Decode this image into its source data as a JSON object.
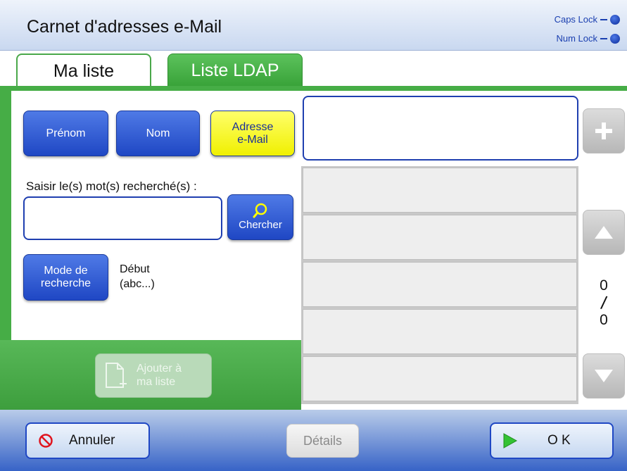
{
  "header": {
    "title": "Carnet d'adresses e-Mail",
    "caps_lock": "Caps Lock",
    "num_lock": "Num Lock"
  },
  "tabs": [
    {
      "label": "Ma liste",
      "active": false
    },
    {
      "label": "Liste LDAP",
      "active": true
    }
  ],
  "filters": {
    "first_name": "Prénom",
    "last_name": "Nom",
    "email_line1": "Adresse",
    "email_line2": "e-Mail",
    "selected": "email"
  },
  "search": {
    "label": "Saisir le(s) mot(s) recherché(s) :",
    "value": "",
    "button": "Chercher"
  },
  "mode": {
    "button_line1": "Mode de",
    "button_line2": "recherche",
    "value_line1": "Début",
    "value_line2": "(abc...)"
  },
  "add_to_list": {
    "line1": "Ajouter à",
    "line2": "ma liste",
    "enabled": false
  },
  "results": {
    "email_field": "",
    "rows": [
      "",
      "",
      "",
      "",
      ""
    ],
    "page_current": "0",
    "page_total": "0"
  },
  "footer": {
    "cancel": "Annuler",
    "details": "Détails",
    "ok": "O K"
  },
  "colors": {
    "accent_green": "#46ad46",
    "accent_blue": "#1f47c4",
    "selected_yellow": "#f0f000",
    "led_blue": "#0c2c9a"
  }
}
